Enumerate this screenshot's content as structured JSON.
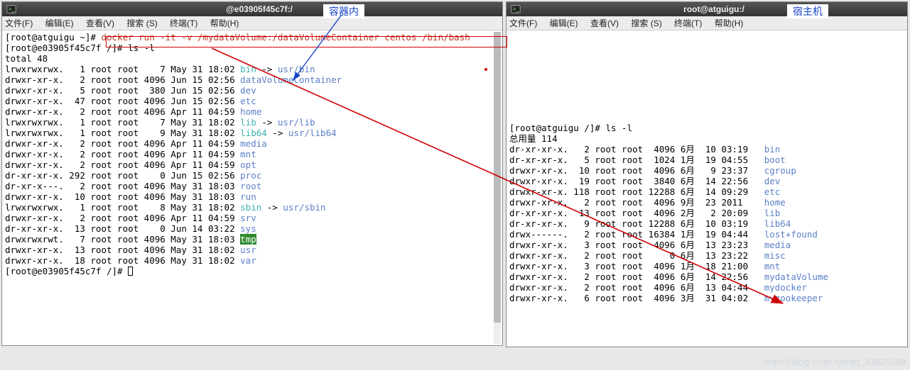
{
  "labels": {
    "container": "容器内",
    "host": "宿主机"
  },
  "watermark": "https://blog.csdn.net/qq_43925089",
  "leftWindow": {
    "title": "@e03905f45c7f:/",
    "menu": {
      "file": "文件(F)",
      "edit": "编辑(E)",
      "view": "查看(V)",
      "search": "搜索 (S)",
      "terminal": "终端(T)",
      "help": "帮助(H)"
    },
    "prompt1_left": "[root@atguigu ~]# ",
    "command1": "docker run -it -v /mydataVolume:/dataVolumeContainer centos /bin/bash",
    "prompt2": "[root@e03905f45c7f /]# ls -l",
    "total": "total 48",
    "rows": [
      {
        "perm": "lrwxrwxrwx.",
        "lnk": "1",
        "u": "root",
        "g": "root",
        "sz": "7",
        "date": "May 31 18:02",
        "name": "bin",
        "arrow": " -> ",
        "target": "usr/bin",
        "namecls": "link",
        "tgtcls": "dir"
      },
      {
        "perm": "drwxr-xr-x.",
        "lnk": "2",
        "u": "root",
        "g": "root",
        "sz": "4096",
        "date": "Jun 15 02:56",
        "name": "dataVolumeContainer",
        "namecls": "dir"
      },
      {
        "perm": "drwxr-xr-x.",
        "lnk": "5",
        "u": "root",
        "g": "root",
        "sz": "380",
        "date": "Jun 15 02:56",
        "name": "dev",
        "namecls": "dir"
      },
      {
        "perm": "drwxr-xr-x.",
        "lnk": "47",
        "u": "root",
        "g": "root",
        "sz": "4096",
        "date": "Jun 15 02:56",
        "name": "etc",
        "namecls": "dir"
      },
      {
        "perm": "drwxr-xr-x.",
        "lnk": "2",
        "u": "root",
        "g": "root",
        "sz": "4096",
        "date": "Apr 11 04:59",
        "name": "home",
        "namecls": "dir"
      },
      {
        "perm": "lrwxrwxrwx.",
        "lnk": "1",
        "u": "root",
        "g": "root",
        "sz": "7",
        "date": "May 31 18:02",
        "name": "lib",
        "arrow": " -> ",
        "target": "usr/lib",
        "namecls": "link",
        "tgtcls": "dir"
      },
      {
        "perm": "lrwxrwxrwx.",
        "lnk": "1",
        "u": "root",
        "g": "root",
        "sz": "9",
        "date": "May 31 18:02",
        "name": "lib64",
        "arrow": " -> ",
        "target": "usr/lib64",
        "namecls": "link",
        "tgtcls": "dir"
      },
      {
        "perm": "drwxr-xr-x.",
        "lnk": "2",
        "u": "root",
        "g": "root",
        "sz": "4096",
        "date": "Apr 11 04:59",
        "name": "media",
        "namecls": "dir"
      },
      {
        "perm": "drwxr-xr-x.",
        "lnk": "2",
        "u": "root",
        "g": "root",
        "sz": "4096",
        "date": "Apr 11 04:59",
        "name": "mnt",
        "namecls": "dir"
      },
      {
        "perm": "drwxr-xr-x.",
        "lnk": "2",
        "u": "root",
        "g": "root",
        "sz": "4096",
        "date": "Apr 11 04:59",
        "name": "opt",
        "namecls": "dir"
      },
      {
        "perm": "dr-xr-xr-x.",
        "lnk": "292",
        "u": "root",
        "g": "root",
        "sz": "0",
        "date": "Jun 15 02:56",
        "name": "proc",
        "namecls": "dir"
      },
      {
        "perm": "dr-xr-x---.",
        "lnk": "2",
        "u": "root",
        "g": "root",
        "sz": "4096",
        "date": "May 31 18:03",
        "name": "root",
        "namecls": "dir"
      },
      {
        "perm": "drwxr-xr-x.",
        "lnk": "10",
        "u": "root",
        "g": "root",
        "sz": "4096",
        "date": "May 31 18:03",
        "name": "run",
        "namecls": "dir"
      },
      {
        "perm": "lrwxrwxrwx.",
        "lnk": "1",
        "u": "root",
        "g": "root",
        "sz": "8",
        "date": "May 31 18:02",
        "name": "sbin",
        "arrow": " -> ",
        "target": "usr/sbin",
        "namecls": "link",
        "tgtcls": "dir"
      },
      {
        "perm": "drwxr-xr-x.",
        "lnk": "2",
        "u": "root",
        "g": "root",
        "sz": "4096",
        "date": "Apr 11 04:59",
        "name": "srv",
        "namecls": "dir"
      },
      {
        "perm": "dr-xr-xr-x.",
        "lnk": "13",
        "u": "root",
        "g": "root",
        "sz": "0",
        "date": "Jun 14 03:22",
        "name": "sys",
        "namecls": "dir"
      },
      {
        "perm": "drwxrwxrwt.",
        "lnk": "7",
        "u": "root",
        "g": "root",
        "sz": "4096",
        "date": "May 31 18:03",
        "name": "tmp",
        "namecls": "hl"
      },
      {
        "perm": "drwxr-xr-x.",
        "lnk": "13",
        "u": "root",
        "g": "root",
        "sz": "4096",
        "date": "May 31 18:02",
        "name": "usr",
        "namecls": "dir"
      },
      {
        "perm": "drwxr-xr-x.",
        "lnk": "18",
        "u": "root",
        "g": "root",
        "sz": "4096",
        "date": "May 31 18:02",
        "name": "var",
        "namecls": "dir"
      }
    ],
    "prompt3": "[root@e03905f45c7f /]# "
  },
  "rightWindow": {
    "title": "root@atguigu:/",
    "menu": {
      "file": "文件(F)",
      "edit": "编辑(E)",
      "view": "查看(V)",
      "search": "搜索 (S)",
      "terminal": "终端(T)",
      "help": "帮助(H)"
    },
    "prompt1": "[root@atguigu /]# ls -l",
    "total": "总用量 114",
    "rows": [
      {
        "perm": "dr-xr-xr-x.",
        "lnk": "2",
        "u": "root",
        "g": "root",
        "sz": "4096",
        "date": "6月  10 03:19",
        "name": "bin",
        "namecls": "dir"
      },
      {
        "perm": "dr-xr-xr-x.",
        "lnk": "5",
        "u": "root",
        "g": "root",
        "sz": "1024",
        "date": "1月  19 04:55",
        "name": "boot",
        "namecls": "dir"
      },
      {
        "perm": "drwxr-xr-x.",
        "lnk": "10",
        "u": "root",
        "g": "root",
        "sz": "4096",
        "date": "6月   9 23:37",
        "name": "cgroup",
        "namecls": "dir"
      },
      {
        "perm": "drwxr-xr-x.",
        "lnk": "19",
        "u": "root",
        "g": "root",
        "sz": "3840",
        "date": "6月  14 22:56",
        "name": "dev",
        "namecls": "dir"
      },
      {
        "perm": "drwxr-xr-x.",
        "lnk": "118",
        "u": "root",
        "g": "root",
        "sz": "12288",
        "date": "6月  14 09:29",
        "name": "etc",
        "namecls": "dir"
      },
      {
        "perm": "drwxr-xr-x.",
        "lnk": "2",
        "u": "root",
        "g": "root",
        "sz": "4096",
        "date": "9月  23 2011",
        "name": "home",
        "namecls": "dir"
      },
      {
        "perm": "dr-xr-xr-x.",
        "lnk": "13",
        "u": "root",
        "g": "root",
        "sz": "4096",
        "date": "2月   2 20:09",
        "name": "lib",
        "namecls": "dir"
      },
      {
        "perm": "dr-xr-xr-x.",
        "lnk": "9",
        "u": "root",
        "g": "root",
        "sz": "12288",
        "date": "6月  10 03:19",
        "name": "lib64",
        "namecls": "dir"
      },
      {
        "perm": "drwx------.",
        "lnk": "2",
        "u": "root",
        "g": "root",
        "sz": "16384",
        "date": "1月  19 04:44",
        "name": "lost+found",
        "namecls": "dir"
      },
      {
        "perm": "drwxr-xr-x.",
        "lnk": "3",
        "u": "root",
        "g": "root",
        "sz": "4096",
        "date": "6月  13 23:23",
        "name": "media",
        "namecls": "dir"
      },
      {
        "perm": "drwxr-xr-x.",
        "lnk": "2",
        "u": "root",
        "g": "root",
        "sz": "0",
        "date": "6月  13 23:22",
        "name": "misc",
        "namecls": "dir"
      },
      {
        "perm": "drwxr-xr-x.",
        "lnk": "3",
        "u": "root",
        "g": "root",
        "sz": "4096",
        "date": "1月  18 21:00",
        "name": "mnt",
        "namecls": "dir"
      },
      {
        "perm": "drwxr-xr-x.",
        "lnk": "2",
        "u": "root",
        "g": "root",
        "sz": "4096",
        "date": "6月  14 22:56",
        "name": "mydataVolume",
        "namecls": "dir"
      },
      {
        "perm": "drwxr-xr-x.",
        "lnk": "2",
        "u": "root",
        "g": "root",
        "sz": "4096",
        "date": "6月  13 04:44",
        "name": "mydocker",
        "namecls": "dir"
      },
      {
        "perm": "drwxr-xr-x.",
        "lnk": "6",
        "u": "root",
        "g": "root",
        "sz": "4096",
        "date": "3月  31 04:02",
        "name": "myzookeeper",
        "namecls": "dir"
      }
    ]
  }
}
